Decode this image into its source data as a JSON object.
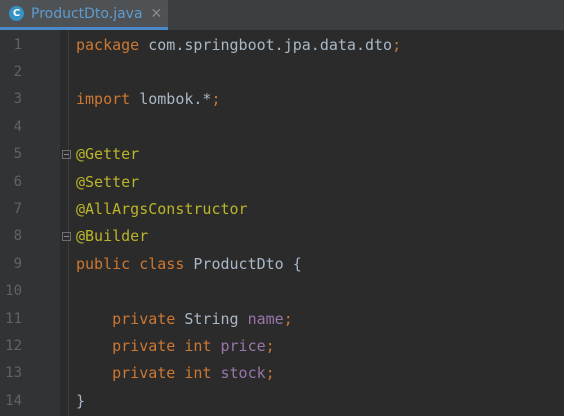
{
  "tab": {
    "icon": "C",
    "label": "ProductDto.java",
    "close": "✕"
  },
  "editor": {
    "lines": [
      {
        "num": "1",
        "tokens": [
          {
            "t": "package",
            "c": "kw"
          },
          {
            "t": " com.springboot.jpa.data.dto",
            "c": "pl"
          },
          {
            "t": ";",
            "c": "semi"
          }
        ]
      },
      {
        "num": "2",
        "tokens": []
      },
      {
        "num": "3",
        "tokens": [
          {
            "t": "import",
            "c": "kw"
          },
          {
            "t": " lombok.*",
            "c": "pl"
          },
          {
            "t": ";",
            "c": "semi"
          }
        ]
      },
      {
        "num": "4",
        "tokens": []
      },
      {
        "num": "5",
        "tokens": [
          {
            "t": "@Getter",
            "c": "ann"
          }
        ]
      },
      {
        "num": "6",
        "tokens": [
          {
            "t": "@Setter",
            "c": "ann"
          }
        ]
      },
      {
        "num": "7",
        "tokens": [
          {
            "t": "@AllArgsConstructor",
            "c": "ann"
          }
        ]
      },
      {
        "num": "8",
        "tokens": [
          {
            "t": "@Builder",
            "c": "ann"
          }
        ]
      },
      {
        "num": "9",
        "tokens": [
          {
            "t": "public",
            "c": "kw"
          },
          {
            "t": " ",
            "c": "pl"
          },
          {
            "t": "class",
            "c": "kw"
          },
          {
            "t": " ProductDto {",
            "c": "pl"
          }
        ]
      },
      {
        "num": "10",
        "tokens": []
      },
      {
        "num": "11",
        "tokens": [
          {
            "t": "    ",
            "c": "pl"
          },
          {
            "t": "private",
            "c": "kw"
          },
          {
            "t": " String ",
            "c": "pl"
          },
          {
            "t": "name",
            "c": "fld"
          },
          {
            "t": ";",
            "c": "semi"
          }
        ]
      },
      {
        "num": "12",
        "tokens": [
          {
            "t": "    ",
            "c": "pl"
          },
          {
            "t": "private",
            "c": "kw"
          },
          {
            "t": " ",
            "c": "pl"
          },
          {
            "t": "int",
            "c": "kw"
          },
          {
            "t": " ",
            "c": "pl"
          },
          {
            "t": "price",
            "c": "fld"
          },
          {
            "t": ";",
            "c": "semi"
          }
        ]
      },
      {
        "num": "13",
        "tokens": [
          {
            "t": "    ",
            "c": "pl"
          },
          {
            "t": "private",
            "c": "kw"
          },
          {
            "t": " ",
            "c": "pl"
          },
          {
            "t": "int",
            "c": "kw"
          },
          {
            "t": " ",
            "c": "pl"
          },
          {
            "t": "stock",
            "c": "fld"
          },
          {
            "t": ";",
            "c": "semi"
          }
        ]
      },
      {
        "num": "14",
        "tokens": [
          {
            "t": "}",
            "c": "pl"
          }
        ]
      }
    ]
  },
  "colors": {
    "keyword": "#cc7832",
    "annotation": "#bbb529",
    "field": "#9876aa",
    "plain": "#a9b7c6",
    "background": "#2b2b2b"
  }
}
